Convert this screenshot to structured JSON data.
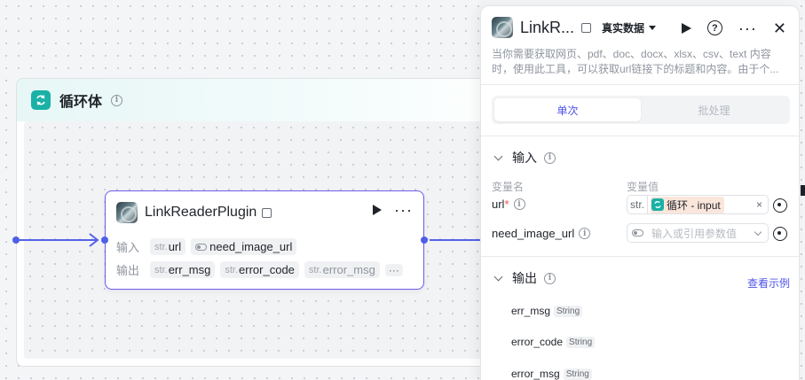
{
  "loop": {
    "title": "循环体",
    "icon": "loop-icon"
  },
  "node": {
    "title": "LinkReaderPlugin",
    "input_label": "输入",
    "output_label": "输出",
    "inputs": [
      {
        "type": "str.",
        "name": "url"
      },
      {
        "type": "toggle",
        "name": "need_image_url"
      }
    ],
    "outputs": [
      {
        "type": "str.",
        "name": "err_msg"
      },
      {
        "type": "str.",
        "name": "error_code"
      },
      {
        "type": "str.",
        "name": "error_msg"
      }
    ],
    "more": "···"
  },
  "panel": {
    "title": "LinkR...",
    "data_mode": "真实数据",
    "description": "当你需要获取网页、pdf、doc、docx、xlsx、csv、text 内容时，使用此工具，可以获取url链接下的标题和内容。由于个...",
    "tabs": [
      "单次",
      "批处理"
    ],
    "input_section": "输入",
    "col_var_name": "变量名",
    "col_var_value": "变量值",
    "url_label": "url",
    "url_required": "*",
    "url_type": "str.",
    "url_ref": "循环 - input",
    "url_clear": "×",
    "need_image_label": "need_image_url",
    "need_image_placeholder": "输入或引用参数值",
    "output_section": "输出",
    "view_example": "查看示例",
    "outputs": [
      {
        "name": "err_msg",
        "type": "String"
      },
      {
        "name": "error_code",
        "type": "String"
      },
      {
        "name": "error_msg",
        "type": "String"
      }
    ]
  },
  "colors": {
    "accent": "#4d53e8",
    "loop_teal": "#1bb1a7",
    "node_border": "#6b5ce7",
    "edge": "#5562e8"
  }
}
